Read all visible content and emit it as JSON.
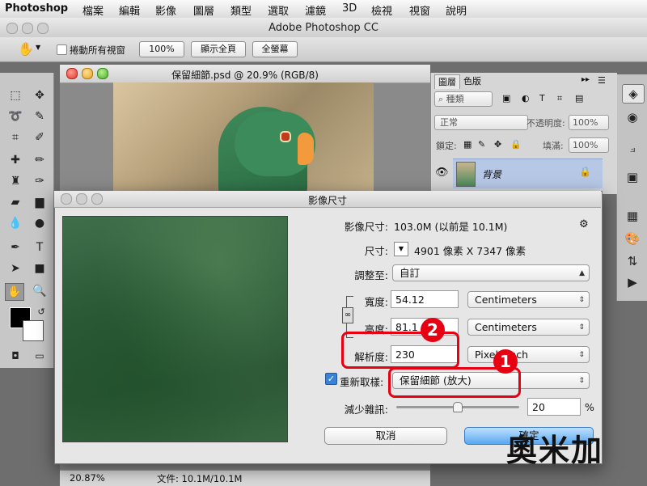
{
  "menubar": {
    "app": "Photoshop",
    "items": [
      "檔案",
      "編輯",
      "影像",
      "圖層",
      "類型",
      "選取",
      "濾鏡",
      "3D",
      "檢視",
      "視窗",
      "說明"
    ]
  },
  "app_title": "Adobe Photoshop CC",
  "options": {
    "scroll_all": "捲動所有視窗",
    "zoom_100": "100%",
    "fit_screen": "顯示全頁",
    "fill_screen": "全螢幕"
  },
  "document": {
    "title": "保留細節.psd @ 20.9% (RGB/8)",
    "zoom": "20.87%",
    "file_info": "文件: 10.1M/10.1M"
  },
  "layers_panel": {
    "tab_layers": "圖層",
    "tab_swatches": "色版",
    "kind": "種類",
    "blend_mode": "正常",
    "opacity_label": "不透明度:",
    "opacity_value": "100%",
    "lock_label": "鎖定:",
    "fill_label": "填滿:",
    "fill_value": "100%",
    "layer_name": "背景"
  },
  "dialog": {
    "title": "影像尺寸",
    "image_size_label": "影像尺寸:",
    "image_size_value": "103.0M (以前是 10.1M)",
    "dimensions_label": "尺寸:",
    "dimensions_value": "4901 像素  X  7347 像素",
    "fit_to_label": "調整至:",
    "fit_to_value": "自訂",
    "width_label": "寬度:",
    "width_value": "54.12",
    "width_unit": "Centimeters",
    "height_label": "高度:",
    "height_value": "81.1",
    "height_unit": "Centimeters",
    "resolution_label": "解析度:",
    "resolution_value": "230",
    "resolution_unit": "Pixels/Inch",
    "resample_label": "重新取樣:",
    "resample_value": "保留細節 (放大)",
    "noise_label": "減少雜訊:",
    "noise_value": "20",
    "noise_unit": "%",
    "cancel": "取消",
    "ok": "確定"
  },
  "annotations": {
    "one": "1",
    "two": "2"
  },
  "watermark": "奧米加",
  "colors": {
    "annotation": "#e60012",
    "ok_button": "#5aa8f0"
  }
}
